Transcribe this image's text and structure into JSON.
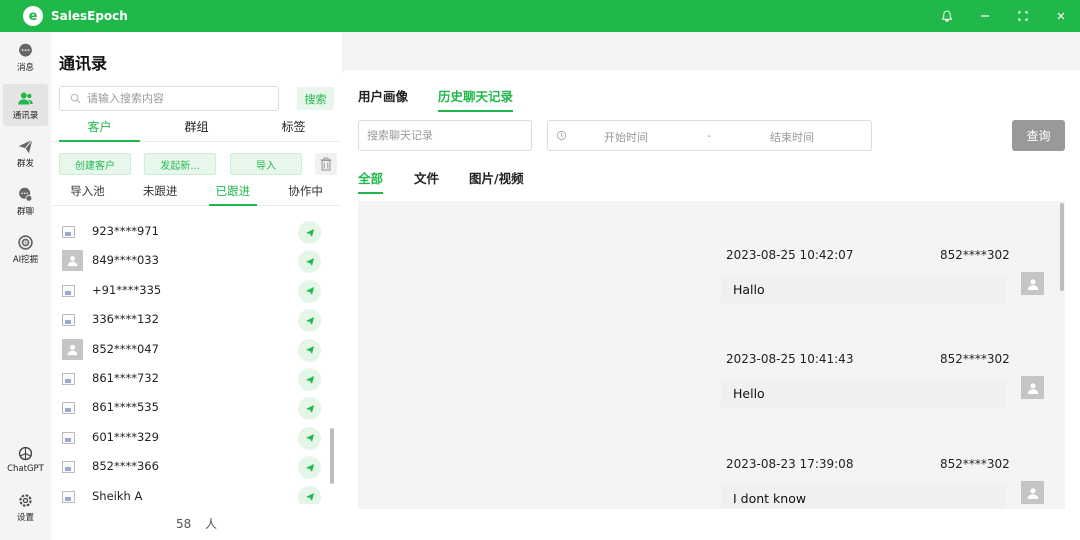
{
  "titlebar": {
    "logo_letter": "e",
    "title": "SalesEpoch"
  },
  "rail": {
    "items": [
      {
        "label": "消息"
      },
      {
        "label": "通讯录"
      },
      {
        "label": "群发"
      },
      {
        "label": "群聊"
      },
      {
        "label": "AI挖掘"
      },
      {
        "label": "ChatGPT"
      },
      {
        "label": "设置"
      }
    ]
  },
  "contacts": {
    "page_title": "通讯录",
    "search_placeholder": "请输入搜索内容",
    "search_button": "搜索",
    "tabs": [
      "客户",
      "群组",
      "标签"
    ],
    "actions": [
      "创建客户",
      "发起新...",
      "导入"
    ],
    "subtabs": [
      "导入池",
      "未跟进",
      "已跟进",
      "协作中"
    ],
    "items": [
      {
        "name": "923****971"
      },
      {
        "name": "849****033"
      },
      {
        "name": "+91****335"
      },
      {
        "name": "336****132"
      },
      {
        "name": "852****047"
      },
      {
        "name": "861****732"
      },
      {
        "name": "861****535"
      },
      {
        "name": "601****329"
      },
      {
        "name": "852****366"
      },
      {
        "name": "Sheikh A"
      }
    ],
    "count": "58",
    "count_unit": "人"
  },
  "main": {
    "tabs": [
      "用户画像",
      "历史聊天记录"
    ],
    "chat_search_placeholder": "搜索聊天记录",
    "date_start": "开始时间",
    "date_separator": "-",
    "date_end": "结束时间",
    "query_button": "查询",
    "filters": [
      "全部",
      "文件",
      "图片/视频"
    ],
    "messages": [
      {
        "time": "2023-08-25 10:42:07",
        "sender": "852****302",
        "text": "Hallo"
      },
      {
        "time": "2023-08-25 10:41:43",
        "sender": "852****302",
        "text": "Hello"
      },
      {
        "time": "2023-08-23 17:39:08",
        "sender": "852****302",
        "text": "I dont know"
      }
    ]
  },
  "colors": {
    "accent": "#21b84b",
    "accent_light": "#e8f7ec"
  }
}
